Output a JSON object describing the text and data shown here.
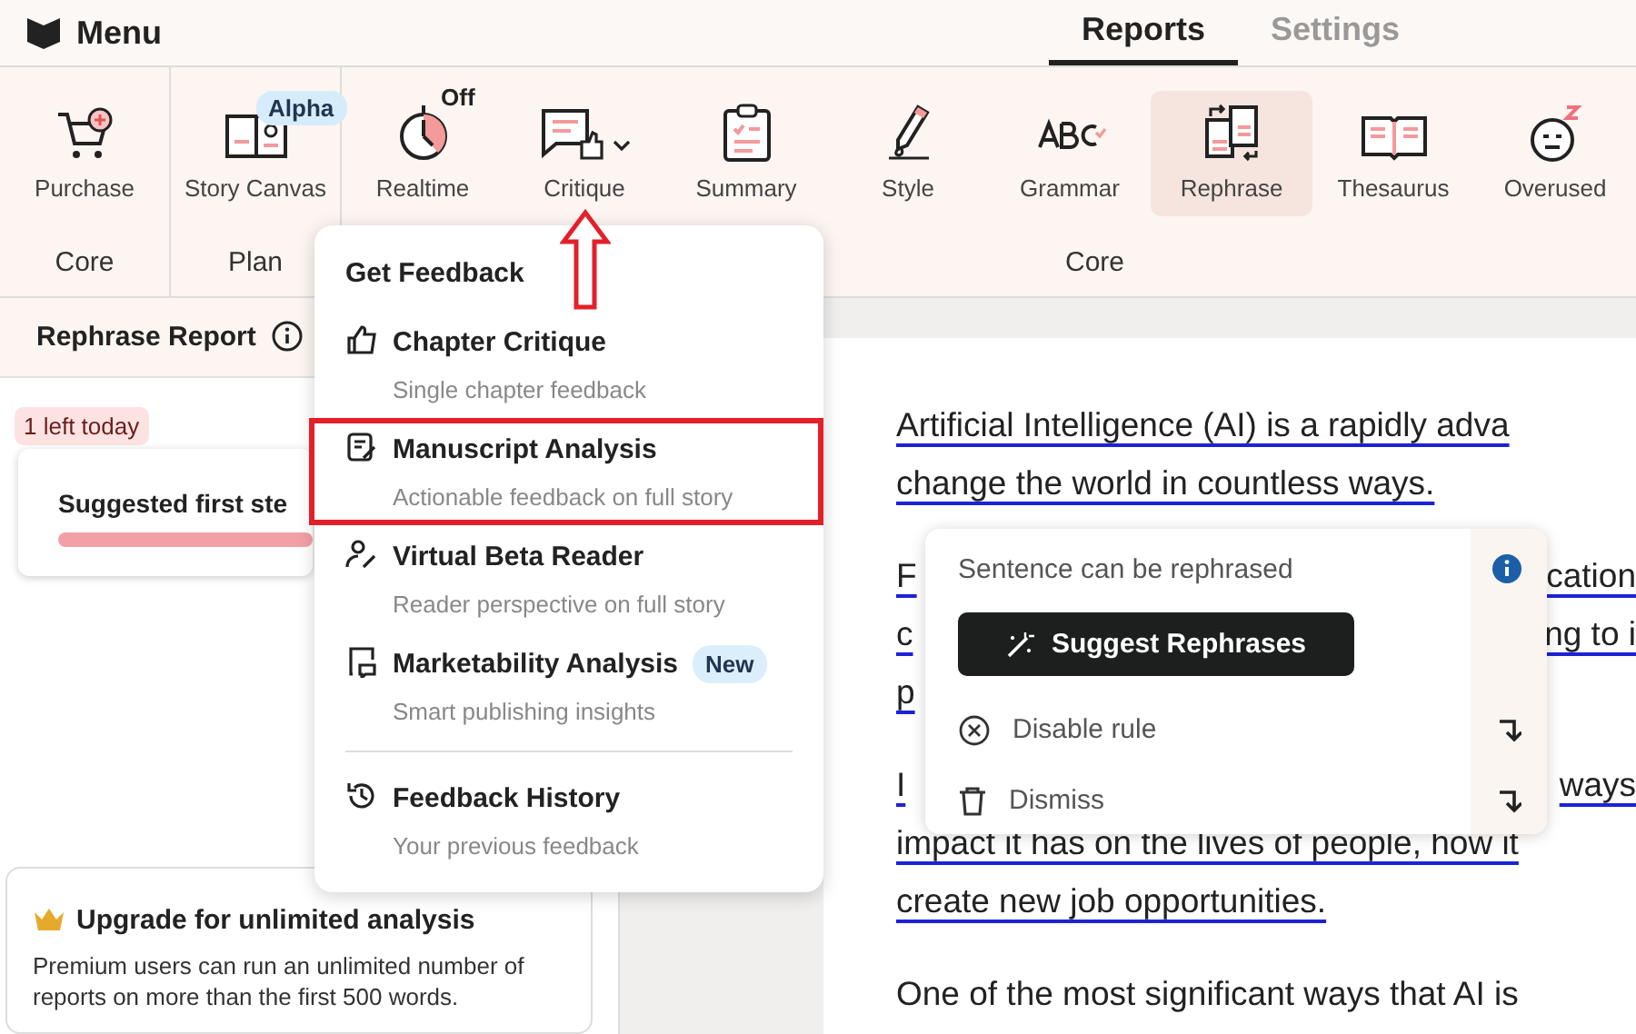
{
  "topbar": {
    "menu_label": "Menu"
  },
  "tabs": [
    {
      "label": "Reports",
      "selected": true
    },
    {
      "label": "Settings",
      "selected": false
    }
  ],
  "ribbon": {
    "groups": [
      {
        "label": "Core",
        "tools": [
          {
            "kind": "cart",
            "label": "Purchase",
            "selected": false
          }
        ]
      },
      {
        "label": "Plan",
        "tools": [
          {
            "kind": "canvas",
            "label": "Story Canvas",
            "selected": false,
            "badge": "Alpha"
          }
        ]
      },
      {
        "label": "Core",
        "tools": [
          {
            "kind": "timer",
            "label": "Realtime",
            "selected": false,
            "status": "Off"
          },
          {
            "kind": "critique",
            "label": "Critique",
            "selected": false,
            "has_menu": true,
            "pointed": true
          },
          {
            "kind": "clipboard",
            "label": "Summary",
            "selected": false
          },
          {
            "kind": "pen",
            "label": "Style",
            "selected": false
          },
          {
            "kind": "abc",
            "label": "Grammar",
            "selected": false
          },
          {
            "kind": "swap",
            "label": "Rephrase",
            "selected": true
          },
          {
            "kind": "book",
            "label": "Thesaurus",
            "selected": false
          },
          {
            "kind": "sleepy",
            "label": "Overused",
            "selected": false
          }
        ]
      }
    ]
  },
  "report_panel": {
    "title": "Rephrase Report",
    "quota_badge": "1 left today",
    "suggestion_title": "Suggested first ste",
    "upgrade": {
      "title": "Upgrade for unlimited analysis",
      "body": "Premium users can run an unlimited number of reports on more than the first 500 words."
    }
  },
  "feedback_menu": {
    "title": "Get Feedback",
    "items": [
      {
        "kind": "thumb",
        "title": "Chapter Critique",
        "subtitle": "Single chapter feedback",
        "highlighted": false
      },
      {
        "kind": "notes",
        "title": "Manuscript Analysis",
        "subtitle": "Actionable feedback on full story",
        "highlighted": true
      },
      {
        "kind": "reader",
        "title": "Virtual Beta Reader",
        "subtitle": "Reader perspective on full story",
        "highlighted": false
      },
      {
        "kind": "market",
        "title": "Marketability Analysis",
        "subtitle": "Smart publishing insights",
        "highlighted": false,
        "badge": "New"
      },
      {
        "kind": "history",
        "title": "Feedback History",
        "subtitle": "Your previous feedback",
        "highlighted": false,
        "divider_before": true
      }
    ]
  },
  "document": {
    "paragraphs": [
      {
        "flagged": true,
        "lines": [
          [
            "Artificial Intelligence (AI) is a rapidly adva"
          ],
          [
            "change the world in countless ways."
          ]
        ]
      },
      {
        "flagged": true,
        "lines": [
          [
            "F",
            "cation"
          ],
          [
            "c",
            "ng to i"
          ],
          [
            "p"
          ]
        ]
      },
      {
        "flagged": true,
        "lines": [
          [
            "I",
            "ways"
          ],
          [
            "impact it has on the lives of people, how it"
          ],
          [
            "create new job opportunities."
          ]
        ]
      },
      {
        "flagged": false,
        "lines": [
          [
            "One of the most significant ways that AI is"
          ]
        ]
      }
    ]
  },
  "rephrase_popup": {
    "message": "Sentence can be rephrased",
    "button": "Suggest Rephrases",
    "actions": [
      {
        "kind": "disable",
        "label": "Disable rule"
      },
      {
        "kind": "dismiss",
        "label": "Dismiss"
      }
    ]
  }
}
